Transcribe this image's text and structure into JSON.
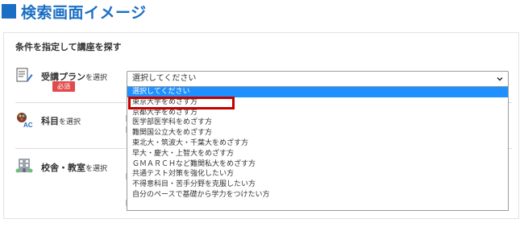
{
  "heading": {
    "title": "検索画面イメージ"
  },
  "panel": {
    "title": "条件を指定して講座を探す"
  },
  "rows": {
    "course_plan": {
      "label": "受講プラン",
      "suffix": "を選択",
      "required": "必須"
    },
    "subject": {
      "label": "科目",
      "suffix": "を選択"
    },
    "school": {
      "label": "校舎・教室",
      "suffix": "を選択"
    }
  },
  "select": {
    "value": "選択してください",
    "options": [
      "選択してください",
      "東京大学をめざす方",
      "京都大学をめざす方",
      "医学部医学科をめざす方",
      "難関国公立大をめざす方",
      "東北大・筑波大・千葉大をめざす方",
      "早大・慶大・上智大をめざす方",
      "ＧＭＡＲＣＨなど難関私大をめざす方",
      "共通テスト対策を強化したい方",
      "不得意科目・苦手分野を克服したい方",
      "自分のペースで基礎から学力をつけたい方"
    ],
    "selected_index": 0,
    "highlighted_index": 1
  },
  "colors": {
    "accent": "#1a6fc4",
    "required": "#e24b4b",
    "selection": "#1e90ff",
    "highlight": "#c40000"
  }
}
